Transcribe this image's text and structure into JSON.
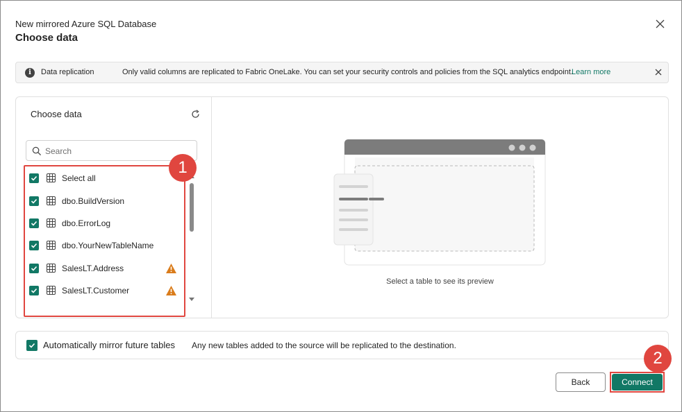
{
  "dialog": {
    "subtitle": "New mirrored Azure SQL Database",
    "title": "Choose data"
  },
  "banner": {
    "title": "Data replication",
    "message": "Only valid columns are replicated to Fabric OneLake. You can set your security controls and policies from the SQL analytics endpoint.",
    "link": "Learn more"
  },
  "left_pane": {
    "title": "Choose data",
    "search_placeholder": "Search",
    "items": [
      {
        "label": "Select all",
        "checked": true,
        "warning": false
      },
      {
        "label": "dbo.BuildVersion",
        "checked": true,
        "warning": false
      },
      {
        "label": "dbo.ErrorLog",
        "checked": true,
        "warning": false
      },
      {
        "label": "dbo.YourNewTableName",
        "checked": true,
        "warning": false
      },
      {
        "label": "SalesLT.Address",
        "checked": true,
        "warning": true
      },
      {
        "label": "SalesLT.Customer",
        "checked": true,
        "warning": true
      }
    ]
  },
  "preview": {
    "caption": "Select a table to see its preview"
  },
  "auto_mirror": {
    "checked": true,
    "label": "Automatically mirror future tables",
    "description": "Any new tables added to the source will be replicated to the destination."
  },
  "footer": {
    "back_label": "Back",
    "connect_label": "Connect"
  },
  "annotations": {
    "badge1": "1",
    "badge2": "2"
  },
  "colors": {
    "accent": "#117865",
    "highlight": "#e0463f",
    "warning": "#da7c1b"
  }
}
